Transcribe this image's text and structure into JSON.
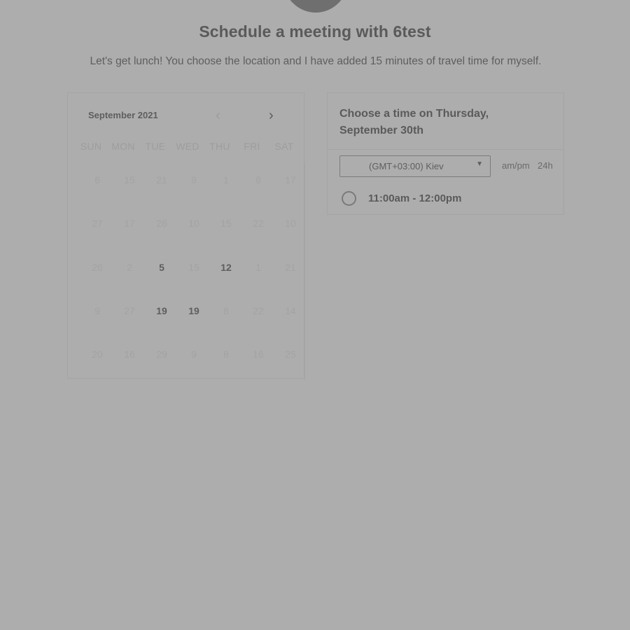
{
  "header": {
    "title": "Schedule a meeting with 6test",
    "subtitle": "Let's get lunch! You choose the location and I have added 15 minutes of travel time for myself."
  },
  "calendar": {
    "month_label": "September 2021",
    "prev_icon": "chevron-left-icon",
    "next_icon": "chevron-right-icon",
    "weekdays": [
      "SUN",
      "MON",
      "TUE",
      "WED",
      "THU",
      "FRI",
      "SAT"
    ],
    "weeks": [
      [
        {
          "d": "6",
          "a": false
        },
        {
          "d": "15",
          "a": false
        },
        {
          "d": "21",
          "a": false
        },
        {
          "d": "9",
          "a": false
        },
        {
          "d": "1",
          "a": false
        },
        {
          "d": "8",
          "a": false
        },
        {
          "d": "17",
          "a": false
        }
      ],
      [
        {
          "d": "27",
          "a": false
        },
        {
          "d": "17",
          "a": false
        },
        {
          "d": "26",
          "a": false
        },
        {
          "d": "10",
          "a": false
        },
        {
          "d": "15",
          "a": false
        },
        {
          "d": "22",
          "a": false
        },
        {
          "d": "10",
          "a": false
        }
      ],
      [
        {
          "d": "26",
          "a": false
        },
        {
          "d": "2",
          "a": false
        },
        {
          "d": "5",
          "a": true
        },
        {
          "d": "15",
          "a": false
        },
        {
          "d": "12",
          "a": true
        },
        {
          "d": "1",
          "a": false
        },
        {
          "d": "21",
          "a": false
        }
      ],
      [
        {
          "d": "9",
          "a": false
        },
        {
          "d": "27",
          "a": false
        },
        {
          "d": "19",
          "a": true
        },
        {
          "d": "19",
          "a": true
        },
        {
          "d": "8",
          "a": false
        },
        {
          "d": "22",
          "a": false
        },
        {
          "d": "14",
          "a": false
        }
      ],
      [
        {
          "d": "20",
          "a": false
        },
        {
          "d": "16",
          "a": false
        },
        {
          "d": "29",
          "a": false
        },
        {
          "d": "9",
          "a": false
        },
        {
          "d": "8",
          "a": false
        },
        {
          "d": "16",
          "a": false
        },
        {
          "d": "25",
          "a": false
        }
      ]
    ]
  },
  "time_panel": {
    "heading": "Choose a time on Thursday, September 30th",
    "timezone": "(GMT+03:00) Kiev",
    "format_ampm": "am/pm",
    "format_24h": "24h",
    "slots": [
      "11:00am - 12:00pm"
    ]
  },
  "colors": {
    "background": "#adadad",
    "text": "#5e5e5e",
    "muted_text": "#a3a3a3"
  }
}
